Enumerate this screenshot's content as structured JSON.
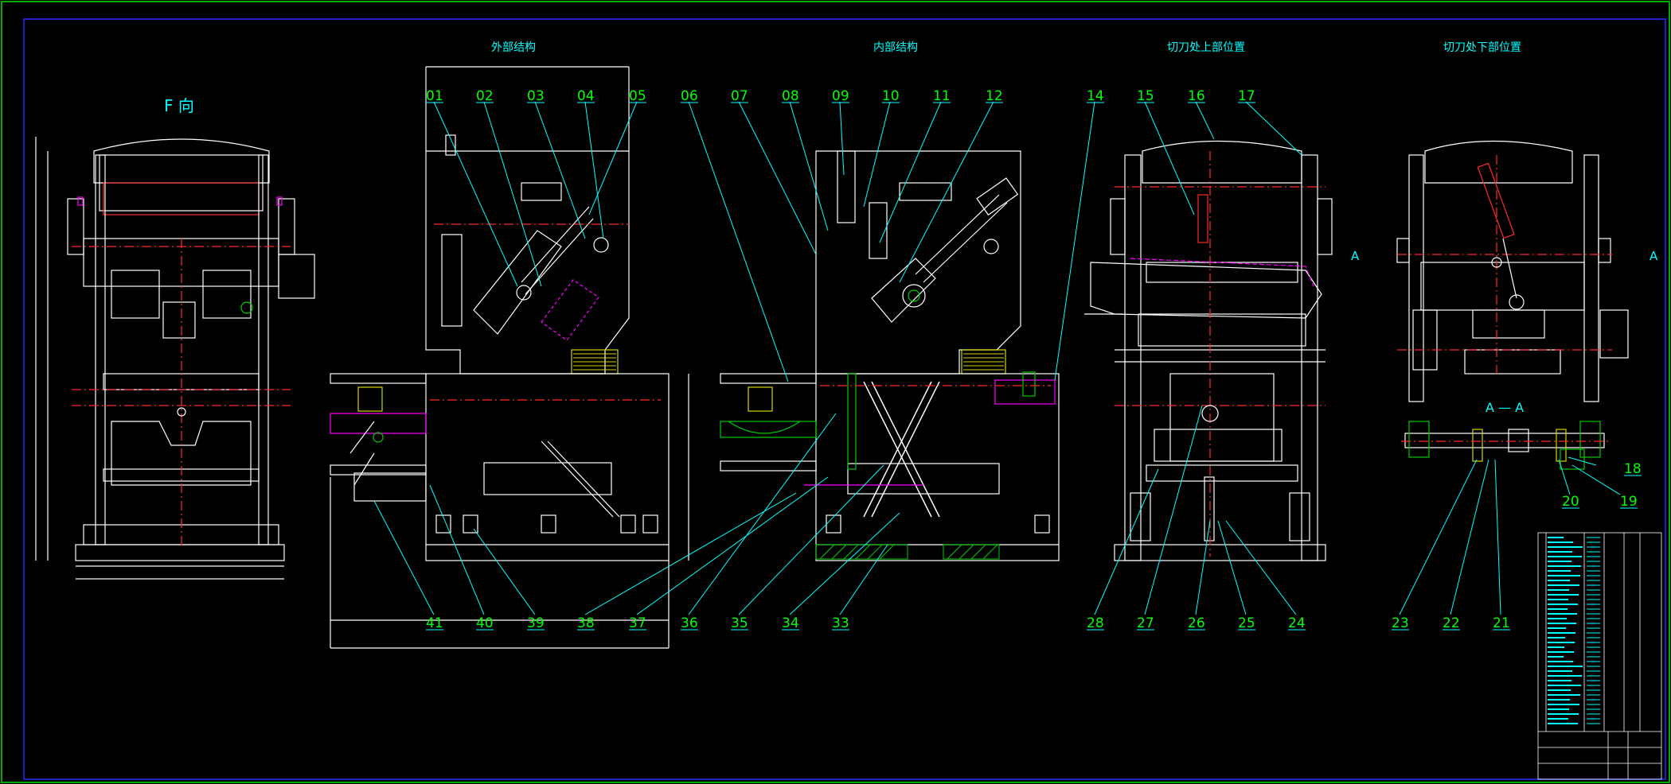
{
  "drawing": {
    "colors": {
      "background": "#000000",
      "border": "#00aa00",
      "inner_border": "#2a2aff",
      "line": "#ffffff",
      "leader": "#00ffff",
      "number": "#00ff00",
      "title": "#00ffff",
      "hatch": "#d4d400",
      "red": "#ff2a2a",
      "magenta": "#ff00ff",
      "green": "#00cc00"
    },
    "view_labels": {
      "f_view": "F 向",
      "outer": "外部结构",
      "inner": "内部结构",
      "upper": "切刀处上部位置",
      "lower": "切刀处下部位置",
      "section": "A — A",
      "section_mark_a": "A",
      "section_mark_b": "A"
    },
    "part_numbers_top": [
      "01",
      "02",
      "03",
      "04",
      "05",
      "06",
      "07",
      "08",
      "09",
      "10",
      "11",
      "12",
      "14",
      "15",
      "16",
      "17"
    ],
    "part_numbers_bottom": [
      "41",
      "40",
      "39",
      "38",
      "37",
      "36",
      "35",
      "34",
      "33",
      "28",
      "27",
      "26",
      "25",
      "24",
      "23",
      "22",
      "21"
    ],
    "part_numbers_right": [
      "18",
      "20",
      "19"
    ]
  }
}
